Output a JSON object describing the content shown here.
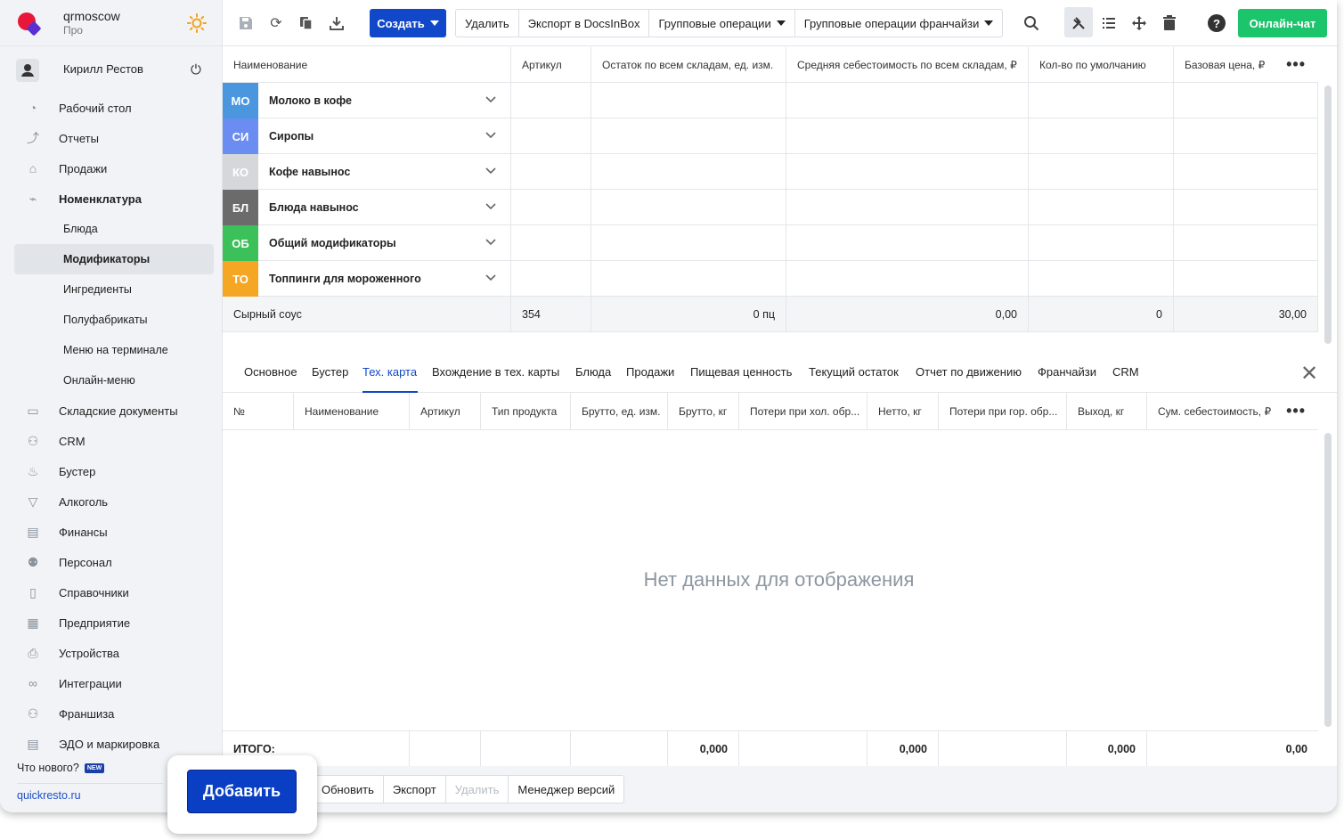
{
  "brand": {
    "name": "qrmoscow",
    "plan": "Про"
  },
  "user": {
    "name": "Кирилл Рестов"
  },
  "nav": [
    {
      "label": "Рабочий стол",
      "icon": "dashboard-icon"
    },
    {
      "label": "Отчеты",
      "icon": "chart-icon"
    },
    {
      "label": "Продажи",
      "icon": "basket-icon"
    },
    {
      "label": "Номенклатура",
      "icon": "tag-icon",
      "bold": true
    },
    {
      "label": "Блюда",
      "sub": true
    },
    {
      "label": "Модификаторы",
      "sub": true,
      "active": true
    },
    {
      "label": "Ингредиенты",
      "sub": true
    },
    {
      "label": "Полуфабрикаты",
      "sub": true
    },
    {
      "label": "Меню на терминале",
      "sub": true
    },
    {
      "label": "Онлайн-меню",
      "sub": true
    },
    {
      "label": "Складские документы",
      "icon": "warehouse-icon"
    },
    {
      "label": "CRM",
      "icon": "crm-icon"
    },
    {
      "label": "Бустер",
      "icon": "booster-icon"
    },
    {
      "label": "Алкоголь",
      "icon": "glass-icon"
    },
    {
      "label": "Финансы",
      "icon": "wallet-icon"
    },
    {
      "label": "Персонал",
      "icon": "people-icon"
    },
    {
      "label": "Справочники",
      "icon": "book-icon"
    },
    {
      "label": "Предприятие",
      "icon": "store-icon"
    },
    {
      "label": "Устройства",
      "icon": "printer-icon"
    },
    {
      "label": "Интеграции",
      "icon": "infinity-icon"
    },
    {
      "label": "Франшиза",
      "icon": "franchise-icon"
    },
    {
      "label": "ЭДО и маркировка",
      "icon": "document-icon"
    }
  ],
  "whats_new": "Что нового?",
  "new_badge": "NEW",
  "site": "quickresto.ru",
  "toolbar": {
    "create": "Создать",
    "delete": "Удалить",
    "export": "Экспорт в DocsInBox",
    "group_ops": "Групповые операции",
    "group_ops_fr": "Групповые операции франчайзи",
    "chat": "Онлайн-чат"
  },
  "grid1": {
    "columns": [
      "Наименование",
      "Артикул",
      "Остаток по всем складам, ед. изм.",
      "Средняя себестоимость по всем складам, ₽",
      "Кол-во по умолчанию",
      "Базовая цена, ₽"
    ],
    "groups": [
      {
        "abbr": "МО",
        "name": "Молоко в кофе",
        "color": "#4a97e0"
      },
      {
        "abbr": "СИ",
        "name": "Сиропы",
        "color": "#6b8cf0"
      },
      {
        "abbr": "КО",
        "name": "Кофе навынос",
        "color": "#d5d7da"
      },
      {
        "abbr": "БЛ",
        "name": "Блюда навынос",
        "color": "#6b6b6b"
      },
      {
        "abbr": "ОБ",
        "name": "Общий модификаторы",
        "color": "#3cc05a"
      },
      {
        "abbr": "ТО",
        "name": "Топпинги для мороженного",
        "color": "#f5a623"
      }
    ],
    "item": {
      "name": "Сырный соус",
      "article": "354",
      "stock": "0 пц",
      "cost": "0,00",
      "qty": "0",
      "price": "30,00"
    }
  },
  "tabs": [
    "Основное",
    "Бустер",
    "Тех. карта",
    "Вхождение в тех. карты",
    "Блюда",
    "Продажи",
    "Пищевая ценность",
    "Текущий остаток",
    "Отчет по движению",
    "Франчайзи",
    "CRM"
  ],
  "grid2": {
    "columns": [
      "№",
      "Наименование",
      "Артикул",
      "Тип продукта",
      "Брутто, ед. изм.",
      "Брутто, кг",
      "Потери при хол. обр...",
      "Нетто, кг",
      "Потери при гор. обр...",
      "Выход, кг",
      "Сум. себестоимость, ₽"
    ],
    "empty": "Нет данных для отображения",
    "total_label": "ИТОГО:",
    "totals": {
      "brutto_kg": "0,000",
      "netto_kg": "0,000",
      "output_kg": "0,000",
      "sum_cost": "0,00"
    }
  },
  "bottom": {
    "add": "Добавить",
    "refresh": "Обновить",
    "export": "Экспорт",
    "delete": "Удалить",
    "versions": "Менеджер версий"
  }
}
